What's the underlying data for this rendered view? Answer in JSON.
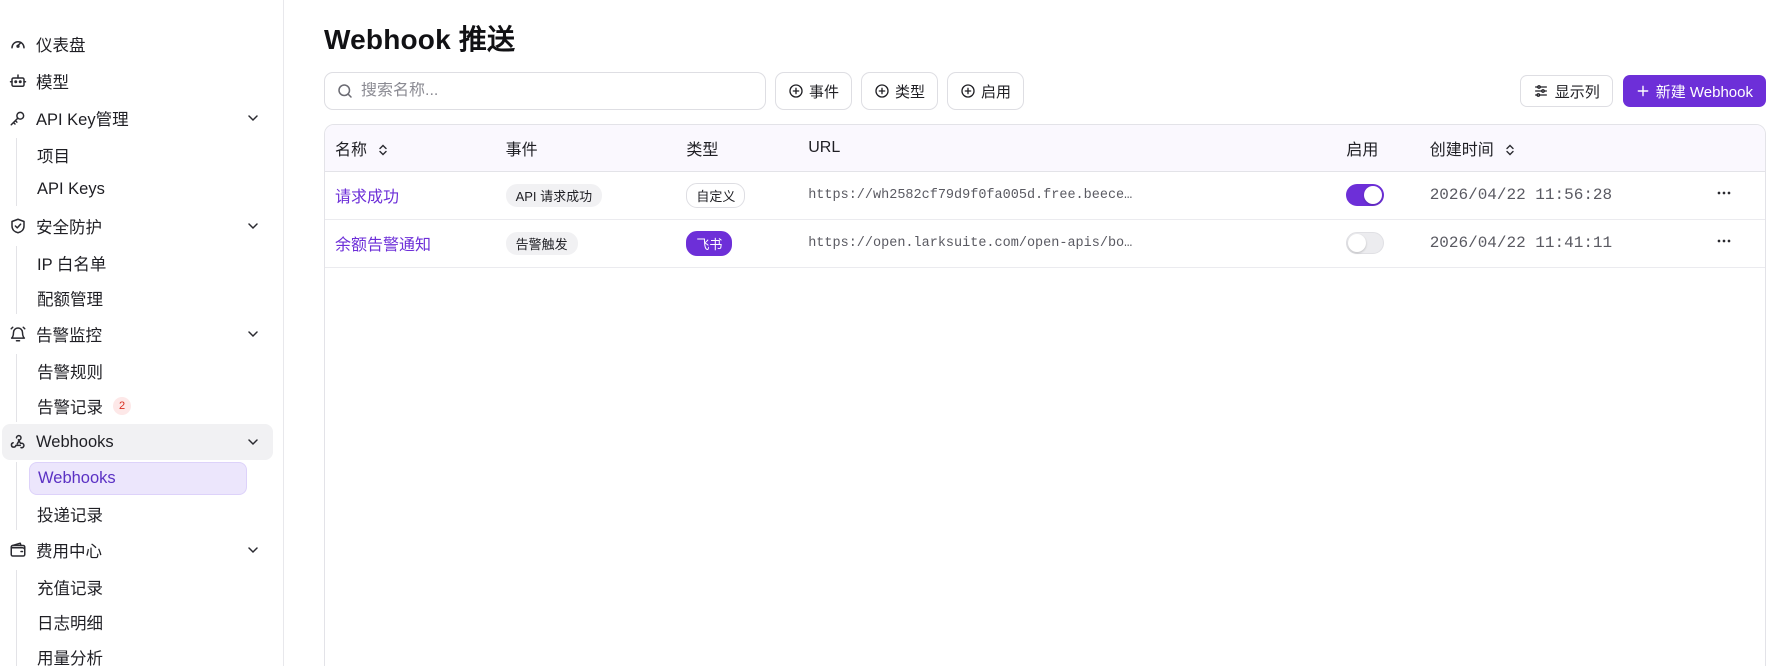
{
  "sidebar": {
    "groups": [
      {
        "label": "仪表盘",
        "icon": "gauge-icon",
        "expandable": false,
        "items": []
      },
      {
        "label": "模型",
        "icon": "robot-icon",
        "expandable": false,
        "items": []
      },
      {
        "label": "API Key管理",
        "icon": "key-icon",
        "expandable": true,
        "items": [
          {
            "label": "项目"
          },
          {
            "label": "API Keys"
          }
        ]
      },
      {
        "label": "安全防护",
        "icon": "shield-check-icon",
        "expandable": true,
        "items": [
          {
            "label": "IP 白名单"
          },
          {
            "label": "配额管理"
          }
        ]
      },
      {
        "label": "告警监控",
        "icon": "bell-icon",
        "expandable": true,
        "items": [
          {
            "label": "告警规则"
          },
          {
            "label": "告警记录",
            "badge": "2"
          }
        ]
      },
      {
        "label": "Webhooks",
        "icon": "webhook-icon",
        "expandable": true,
        "active": true,
        "items": [
          {
            "label": "Webhooks",
            "active": true
          },
          {
            "label": "投递记录"
          }
        ]
      },
      {
        "label": "费用中心",
        "icon": "wallet-icon",
        "expandable": true,
        "items": [
          {
            "label": "充值记录"
          },
          {
            "label": "日志明细"
          },
          {
            "label": "用量分析"
          }
        ]
      }
    ]
  },
  "page": {
    "title": "Webhook 推送"
  },
  "toolbar": {
    "search_placeholder": "搜索名称...",
    "filter_event": "事件",
    "filter_type": "类型",
    "filter_enabled": "启用",
    "columns_label": "显示列",
    "new_label": "新建 Webhook"
  },
  "table": {
    "headers": {
      "name": "名称",
      "event": "事件",
      "type": "类型",
      "url": "URL",
      "enabled": "启用",
      "created": "创建时间"
    },
    "rows": [
      {
        "name": "请求成功",
        "event": "API 请求成功",
        "type": "自定义",
        "type_style": "outline",
        "url": "https://wh2582cf79d9f0fa005d.free.beece…",
        "enabled": true,
        "created": "2026/04/22 11:56:28"
      },
      {
        "name": "余额告警通知",
        "event": "告警触发",
        "type": "飞书",
        "type_style": "filled",
        "url": "https://open.larksuite.com/open-apis/bo…",
        "enabled": false,
        "created": "2026/04/22 11:41:11"
      }
    ]
  },
  "colors": {
    "accent": "#6d2fd8",
    "active_nav_bg": "#ece6fc",
    "badge_red": "#d92d20"
  }
}
